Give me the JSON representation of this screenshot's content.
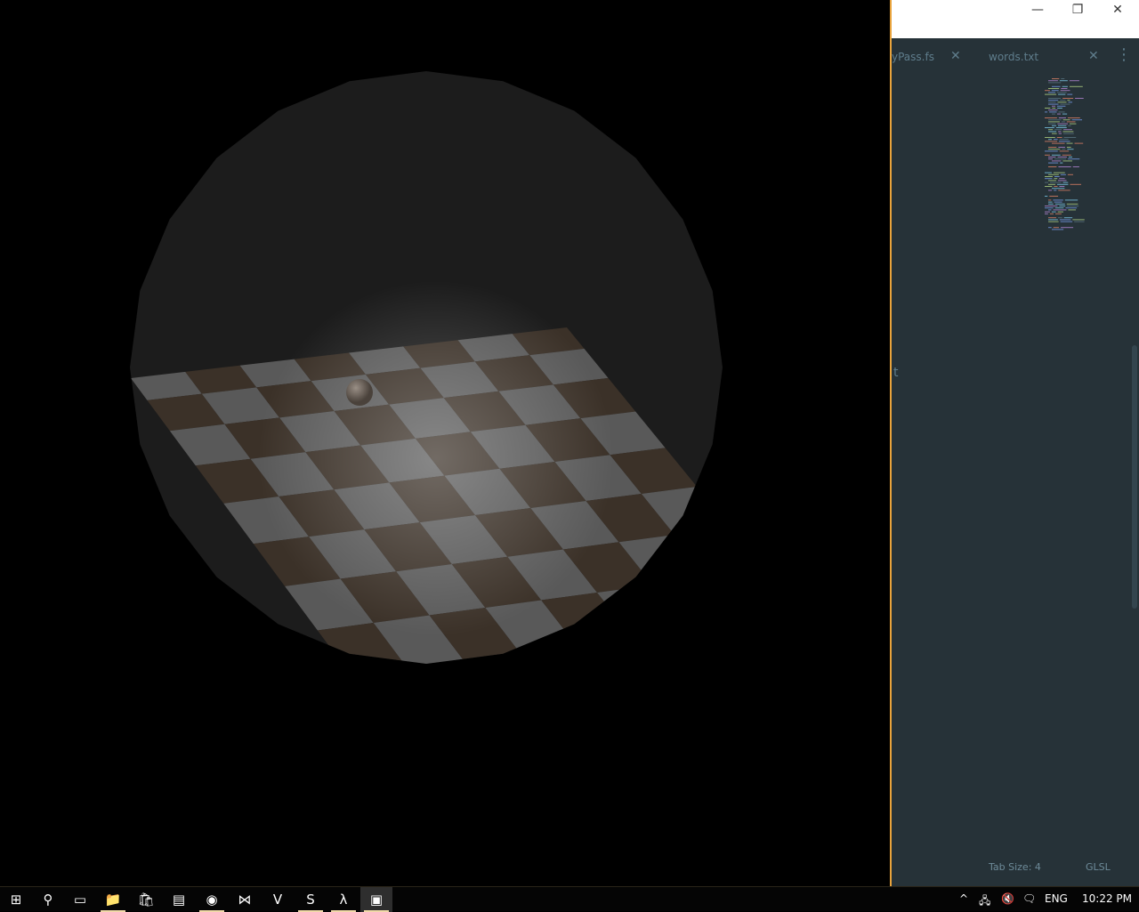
{
  "scene": {
    "backdrop_color": "#1c1c1c",
    "floor_light": "#595959",
    "floor_dark": "#3b3128",
    "grid": 8
  },
  "editor": {
    "window_controls": {
      "minimize": "—",
      "restore": "❐",
      "close": "✕"
    },
    "tabs": [
      {
        "label": "yPass.fs",
        "close": "✕"
      },
      {
        "label": "words.txt",
        "close": "✕"
      }
    ],
    "more_icon": "⋮",
    "gutter_char": "t",
    "status": {
      "tab_size": "Tab Size: 4",
      "syntax": "GLSL"
    },
    "accent": "#e8a33c"
  },
  "taskbar": {
    "apps": [
      {
        "icon": "windows-start-icon",
        "glyph": "⊞"
      },
      {
        "icon": "search-icon",
        "glyph": "⚲"
      },
      {
        "icon": "task-view-icon",
        "glyph": "▭"
      },
      {
        "icon": "file-explorer-icon",
        "glyph": "📁"
      },
      {
        "icon": "store-icon",
        "glyph": "🛍"
      },
      {
        "icon": "control-panel-icon",
        "glyph": "▤"
      },
      {
        "icon": "chrome-icon",
        "glyph": "◉"
      },
      {
        "icon": "visual-studio-icon",
        "glyph": "⋈"
      },
      {
        "icon": "vim-icon",
        "glyph": "V"
      },
      {
        "icon": "sublime-text-icon",
        "glyph": "S"
      },
      {
        "icon": "lambda-app-icon",
        "glyph": "λ"
      },
      {
        "icon": "window-app-icon",
        "glyph": "▣"
      }
    ],
    "tray": {
      "chevron": "^",
      "network": "🖧",
      "volume": "🔇",
      "notifications": "🗨",
      "language": "ENG",
      "time": "10:22 PM"
    }
  }
}
